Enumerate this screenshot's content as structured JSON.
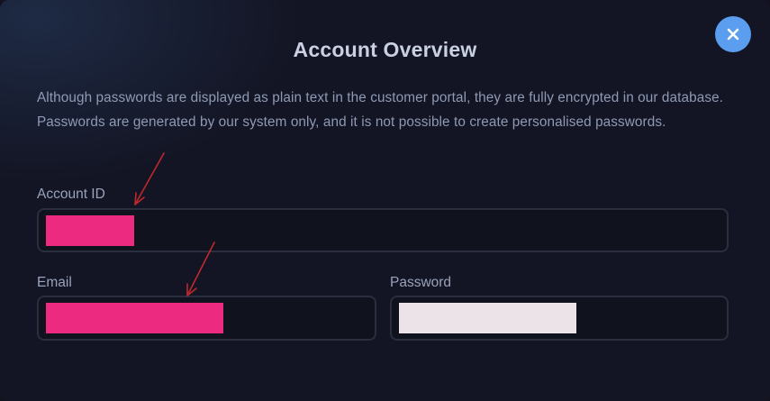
{
  "modal": {
    "title": "Account Overview",
    "description": "Although passwords are displayed as plain text in the customer portal, they are fully encrypted in our database. Passwords are generated by our system only, and it is not possible to create personalised passwords.",
    "close_icon": "close-icon",
    "fields": {
      "account_id": {
        "label": "Account ID",
        "value": "",
        "value_redacted": true
      },
      "email": {
        "label": "Email",
        "value": "",
        "value_redacted": true
      },
      "password": {
        "label": "Password",
        "value": "",
        "value_redacted": true
      }
    }
  },
  "colors": {
    "background": "#131524",
    "title": "#c9d0e2",
    "description": "#8f9ab4",
    "close_button": "#5b9ef0",
    "field_border": "#2a2e3f",
    "redaction_pink": "#ec2a7f",
    "redaction_light": "#ebe3e8",
    "annotation_arrow": "#c0282d"
  }
}
